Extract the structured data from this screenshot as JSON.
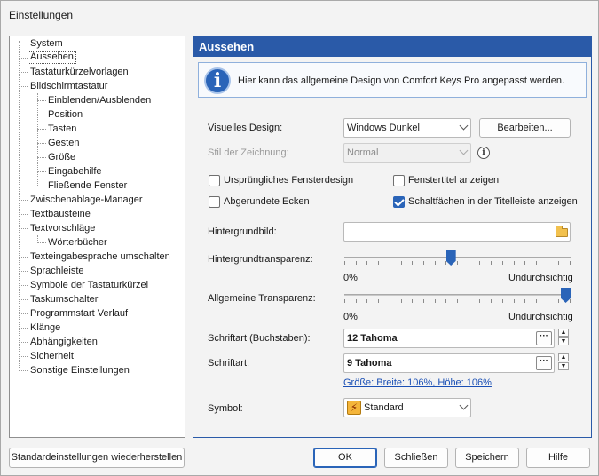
{
  "window": {
    "title": "Einstellungen"
  },
  "tree": {
    "items": [
      {
        "label": "System"
      },
      {
        "label": "Aussehen"
      },
      {
        "label": "Tastaturkürzelvorlagen"
      },
      {
        "label": "Bildschirmtastatur"
      },
      {
        "label": "Einblenden/Ausblenden"
      },
      {
        "label": "Position"
      },
      {
        "label": "Tasten"
      },
      {
        "label": "Gesten"
      },
      {
        "label": "Größe"
      },
      {
        "label": "Eingabehilfe"
      },
      {
        "label": "Fließende Fenster"
      },
      {
        "label": "Zwischenablage-Manager"
      },
      {
        "label": "Textbausteine"
      },
      {
        "label": "Textvorschläge"
      },
      {
        "label": "Wörterbücher"
      },
      {
        "label": "Texteingabesprache umschalten"
      },
      {
        "label": "Sprachleiste"
      },
      {
        "label": "Symbole der Tastaturkürzel"
      },
      {
        "label": "Taskumschalter"
      },
      {
        "label": "Programmstart Verlauf"
      },
      {
        "label": "Klänge"
      },
      {
        "label": "Abhängigkeiten"
      },
      {
        "label": "Sicherheit"
      },
      {
        "label": "Sonstige Einstellungen"
      }
    ],
    "selected": "Aussehen"
  },
  "content": {
    "header": "Aussehen",
    "info": "Hier kann das allgemeine Design von Comfort Keys Pro angepasst werden.",
    "visual_design": {
      "label": "Visuelles Design:",
      "value": "Windows Dunkel",
      "edit_button": "Bearbeiten..."
    },
    "drawing_style": {
      "label": "Stil der Zeichnung:",
      "value": "Normal"
    },
    "checkboxes": {
      "original_frame": {
        "label": "Ursprüngliches Fensterdesign",
        "checked": false
      },
      "show_window_title": {
        "label": "Fenstertitel anzeigen",
        "checked": false
      },
      "rounded_corners": {
        "label": "Abgerundete Ecken",
        "checked": false
      },
      "titlebar_buttons": {
        "label": "Schaltfächen in der Titelleiste anzeigen",
        "checked": true
      }
    },
    "background_image": {
      "label": "Hintergrundbild:",
      "value": ""
    },
    "background_transparency": {
      "label": "Hintergrundtransparenz:",
      "min_label": "0%",
      "max_label": "Undurchsichtig",
      "level": 0.47
    },
    "general_transparency": {
      "label": "Allgemeine Transparenz:",
      "min_label": "0%",
      "max_label": "Undurchsichtig",
      "level": 1.0
    },
    "font_letters": {
      "label": "Schriftart (Buchstaben):",
      "value": "12 Tahoma"
    },
    "font": {
      "label": "Schriftart:",
      "value": "9 Tahoma"
    },
    "size_link": "Größe: Breite: 106%, Höhe: 106%",
    "symbol": {
      "label": "Symbol:",
      "value": "Standard"
    }
  },
  "footer": {
    "restore_defaults": "Standardeinstellungen wiederherstellen",
    "ok": "OK",
    "close": "Schließen",
    "save": "Speichern",
    "help": "Hilfe"
  },
  "colors": {
    "accent": "#2a5aa8",
    "link": "#1a4fb5"
  }
}
